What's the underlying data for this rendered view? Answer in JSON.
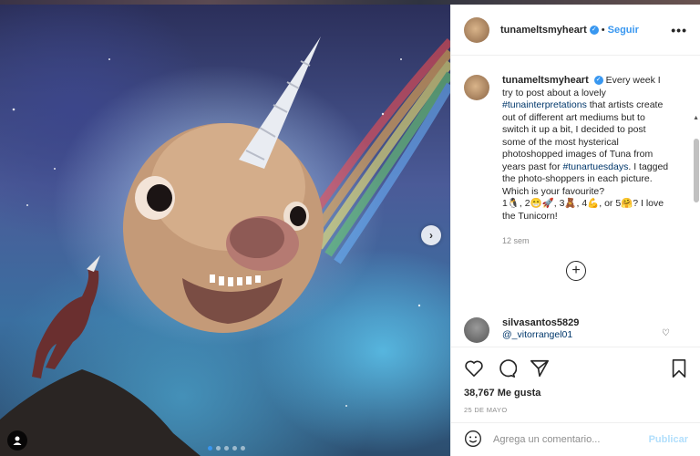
{
  "post": {
    "username": "tunameltsmyheart",
    "follow_label": "Seguir",
    "separator": "•",
    "more_label": "•••",
    "caption": {
      "text_1": "Every week I try to post about a lovely",
      "hashtag_1": "#tunainterpretations",
      "text_2": "that artists create out of different art mediums but to switch it up a bit, I decided to post some of the most hysterical photoshopped images of Tuna from years past for",
      "hashtag_2": "#tunartuesdays",
      "text_3": ". I tagged the photo-shoppers in each picture. Which is your favourite?",
      "text_4": "1🐧, 2😁🚀, 3🧸, 4💪, or 5🤗? I love the Tunicorn!"
    },
    "time_ago": "12 sem",
    "likes": "38,767 Me gusta",
    "date": "25 DE MAYO"
  },
  "comment": {
    "username": "silvasantos5829",
    "mention": "@_vitorrangel01"
  },
  "add_comment": {
    "placeholder": "Agrega un comentario...",
    "publish_label": "Publicar"
  },
  "carousel": {
    "slides": 5,
    "active": 1
  },
  "colors": {
    "accent": "#3897f0",
    "publish_disabled": "#b2dffc",
    "muted": "#8e8e8e"
  }
}
